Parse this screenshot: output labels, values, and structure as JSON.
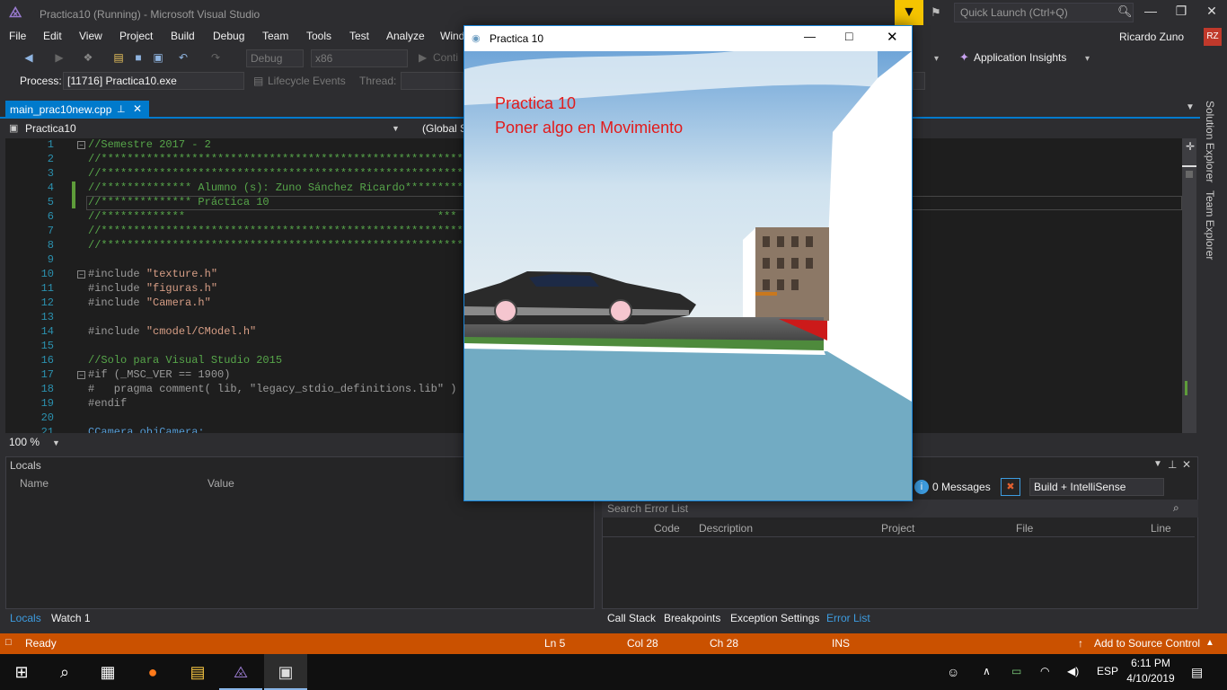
{
  "window": {
    "title": "Practica10 (Running) - Microsoft Visual Studio",
    "quick_launch": "Quick Launch (Ctrl+Q)",
    "user": "Ricardo Zuno",
    "avatar": "RZ"
  },
  "menu": [
    "File",
    "Edit",
    "View",
    "Project",
    "Build",
    "Debug",
    "Team",
    "Tools",
    "Test",
    "Analyze",
    "Windo"
  ],
  "toolbar": {
    "config": "Debug",
    "platform": "x86",
    "continue": "Conti",
    "app_insights": "Application Insights",
    "process_label": "Process:",
    "process_value": "[11716] Practica10.exe",
    "lifecycle": "Lifecycle Events",
    "thread": "Thread:"
  },
  "editor": {
    "tab": "main_prac10new.cpp",
    "project_combo": "Practica10",
    "scope_combo": "(Global S",
    "zoom": "100 %",
    "lines": [
      {
        "n": "1",
        "t": "//Semestre 2017 - 2",
        "c": "cmt"
      },
      {
        "n": "2",
        "t": "//*************************************************************************************",
        "c": "cmt"
      },
      {
        "n": "3",
        "t": "//*************************************************************************************",
        "c": "cmt"
      },
      {
        "n": "4",
        "t": "//************** Alumno (s): Zuno Sánchez Ricardo*********************",
        "c": "cmt"
      },
      {
        "n": "5",
        "t": "//************** Práctica 10",
        "c": "cmt"
      },
      {
        "n": "6",
        "t": "//*************                                       ***",
        "c": "cmt"
      },
      {
        "n": "7",
        "t": "//*************************************************************************************",
        "c": "cmt"
      },
      {
        "n": "8",
        "t": "//*************************************************************************************",
        "c": "cmt"
      },
      {
        "n": "9",
        "t": "",
        "c": "pp"
      },
      {
        "n": "10",
        "t": "#include \"texture.h\"",
        "c": "inc"
      },
      {
        "n": "11",
        "t": "#include \"figuras.h\"",
        "c": "inc"
      },
      {
        "n": "12",
        "t": "#include \"Camera.h\"",
        "c": "inc"
      },
      {
        "n": "13",
        "t": "",
        "c": "pp"
      },
      {
        "n": "14",
        "t": "#include \"cmodel/CModel.h\"",
        "c": "inc"
      },
      {
        "n": "15",
        "t": "",
        "c": "pp"
      },
      {
        "n": "16",
        "t": "//Solo para Visual Studio 2015",
        "c": "cmt"
      },
      {
        "n": "17",
        "t": "#if (_MSC_VER == 1900)",
        "c": "pp"
      },
      {
        "n": "18",
        "t": "#   pragma comment( lib, \"legacy_stdio_definitions.lib\" )",
        "c": "pp"
      },
      {
        "n": "19",
        "t": "#endif",
        "c": "pp"
      },
      {
        "n": "20",
        "t": "",
        "c": "pp"
      },
      {
        "n": "21",
        "t": "CCamera objCamera;",
        "c": "kw"
      }
    ]
  },
  "locals": {
    "title": "Locals",
    "col_name": "Name",
    "col_value": "Value",
    "tabs": [
      "Locals",
      "Watch 1"
    ]
  },
  "errors": {
    "messages": "0 Messages",
    "scope": "Build + IntelliSense",
    "search": "Search Error List",
    "cols": [
      "Code",
      "Description",
      "Project",
      "File",
      "Line"
    ],
    "tabs": [
      "Call Stack",
      "Breakpoints",
      "Exception Settings",
      "Error List"
    ]
  },
  "status": {
    "ready": "Ready",
    "ln": "Ln 5",
    "col": "Col 28",
    "ch": "Ch 28",
    "ins": "INS",
    "source_control": "Add to Source Control"
  },
  "taskbar": {
    "time": "6:11 PM",
    "date": "4/10/2019",
    "lang": "ESP"
  },
  "glwindow": {
    "title": "Practica 10",
    "line1": "Practica 10",
    "line2": "Poner algo en Movimiento"
  },
  "sidebar": [
    "Solution Explorer",
    "Team Explorer"
  ],
  "colors": {
    "accent": "#007acc",
    "status": "#ca5100",
    "overlay_text": "#e21b1b"
  }
}
